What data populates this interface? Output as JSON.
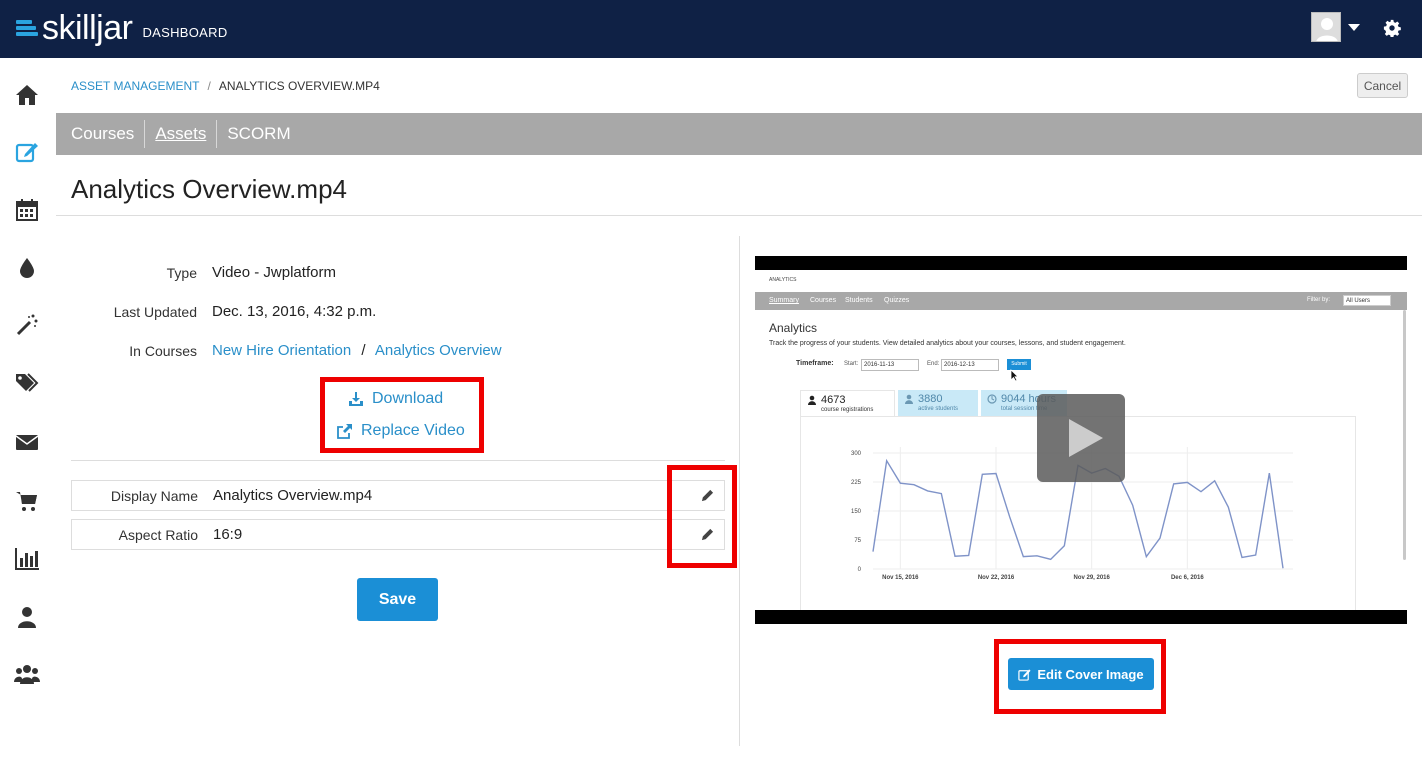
{
  "app": {
    "logo_word": "skilljar",
    "logo_sub": "DASHBOARD"
  },
  "breadcrumb": {
    "parent": "ASSET MANAGEMENT",
    "separator": "/",
    "current": "ANALYTICS OVERVIEW.MP4"
  },
  "toolbar": {
    "cancel_label": "Cancel"
  },
  "subnav": {
    "tabs": [
      {
        "label": "Courses",
        "active": false
      },
      {
        "label": "Assets",
        "active": true
      },
      {
        "label": "SCORM",
        "active": false
      }
    ]
  },
  "page": {
    "title": "Analytics Overview.mp4"
  },
  "details": {
    "type_label": "Type",
    "type_value": "Video - Jwplatform",
    "updated_label": "Last Updated",
    "updated_value": "Dec. 13, 2016, 4:32 p.m.",
    "courses_label": "In Courses",
    "courses": [
      "New Hire Orientation",
      "Analytics Overview"
    ],
    "courses_sep": "/"
  },
  "actions": {
    "download": "Download",
    "replace": "Replace Video"
  },
  "fields": [
    {
      "label": "Display Name",
      "value": "Analytics Overview.mp4"
    },
    {
      "label": "Aspect Ratio",
      "value": "16:9"
    }
  ],
  "form": {
    "save_label": "Save"
  },
  "cover": {
    "edit_label": "Edit Cover Image"
  },
  "video_preview": {
    "top_label": "ANALYTICS",
    "tabs": [
      "Summary",
      "Courses",
      "Students",
      "Quizzes"
    ],
    "filter_label": "Filter by:",
    "filter_value": "All Users",
    "heading": "Analytics",
    "description": "Track the progress of your students. View detailed analytics about your courses, lessons, and student engagement.",
    "timeframe_label": "Timeframe:",
    "start_label": "Start:",
    "start_value": "2016-11-13",
    "end_label": "End:",
    "end_value": "2016-12-13",
    "submit_label": "Submit",
    "stats": [
      {
        "number": "4673",
        "label": "course registrations"
      },
      {
        "number": "3880",
        "label": "active students"
      },
      {
        "number": "9044 hours",
        "label": "total session time"
      }
    ]
  },
  "chart_data": {
    "type": "line",
    "y_ticks": [
      "300",
      "225",
      "150",
      "75",
      "0"
    ],
    "x_ticks": [
      "Nov 15, 2016",
      "Nov 22, 2016",
      "Nov 29, 2016",
      "Dec 6, 2016"
    ],
    "ylim": [
      0,
      300
    ],
    "values": [
      45,
      280,
      222,
      218,
      202,
      195,
      33,
      35,
      245,
      247,
      135,
      32,
      34,
      25,
      60,
      268,
      248,
      260,
      240,
      165,
      32,
      80,
      220,
      224,
      200,
      228,
      160,
      30,
      36,
      248,
      2
    ],
    "color": "#7f93c8"
  }
}
